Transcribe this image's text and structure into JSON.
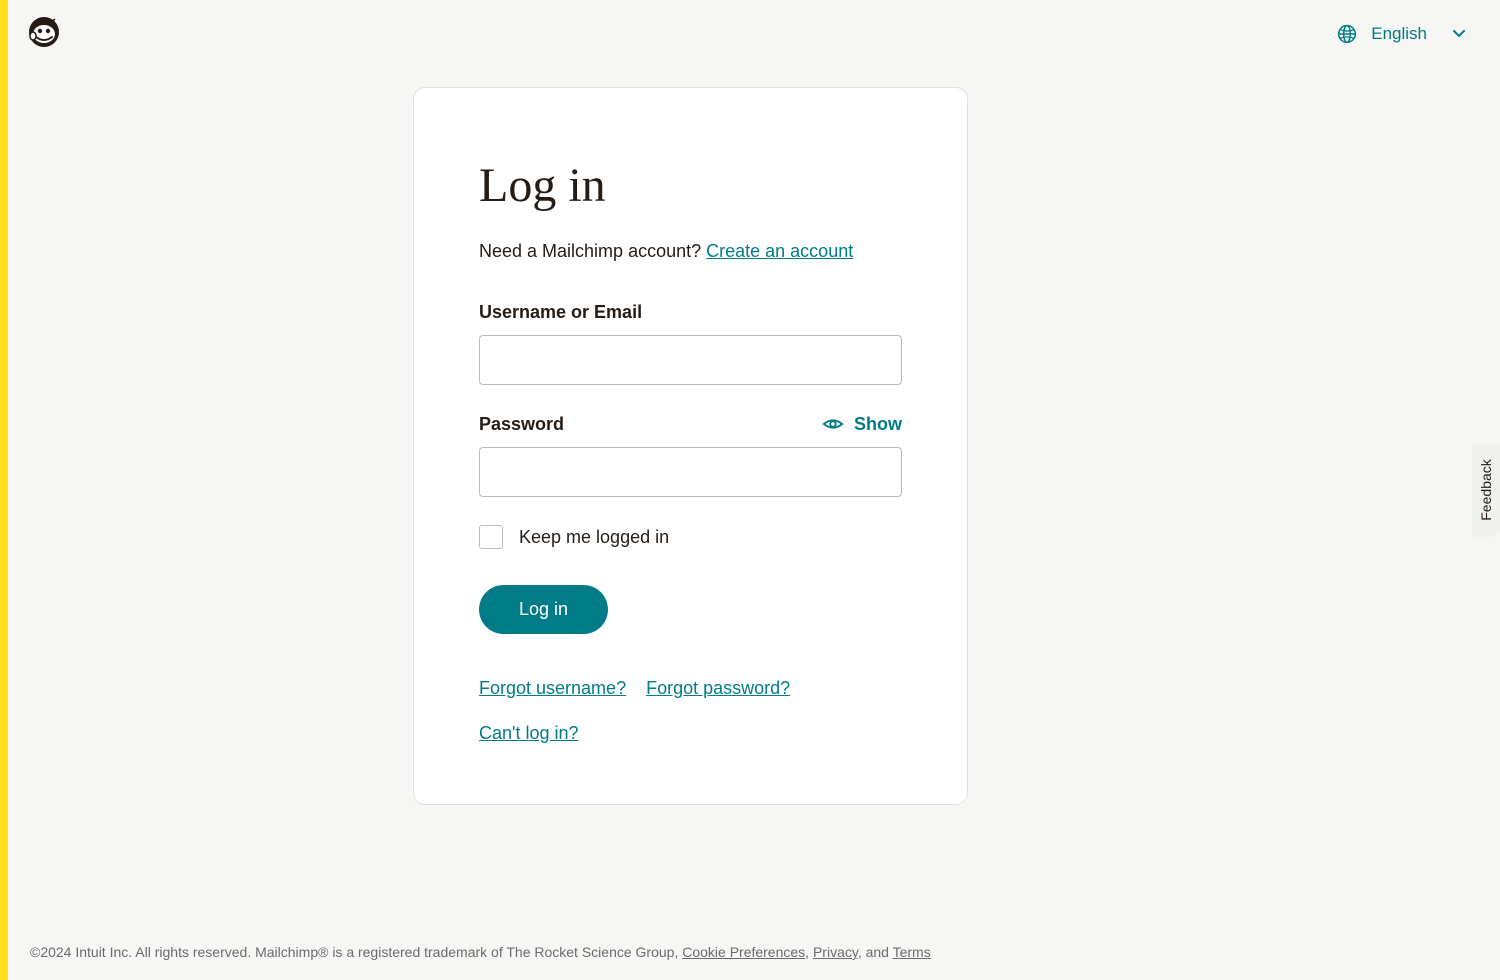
{
  "header": {
    "language": "English"
  },
  "card": {
    "title": "Log in",
    "subtitle_prefix": "Need a Mailchimp account? ",
    "create_account_link": "Create an account",
    "username_label": "Username or Email",
    "username_value": "",
    "password_label": "Password",
    "password_value": "",
    "show_toggle": "Show",
    "keep_logged_in": "Keep me logged in",
    "login_button": "Log in",
    "forgot_username": "Forgot username?",
    "forgot_password": "Forgot password?",
    "cant_login": "Can't log in?"
  },
  "footer": {
    "copyright_prefix": "©2024 Intuit Inc. All rights reserved. Mailchimp® is a registered trademark of The Rocket Science Group, ",
    "cookie_link": "Cookie Preferences",
    "sep1": ", ",
    "privacy_link": "Privacy",
    "sep2": ", and ",
    "terms_link": "Terms"
  },
  "feedback": {
    "label": "Feedback"
  }
}
